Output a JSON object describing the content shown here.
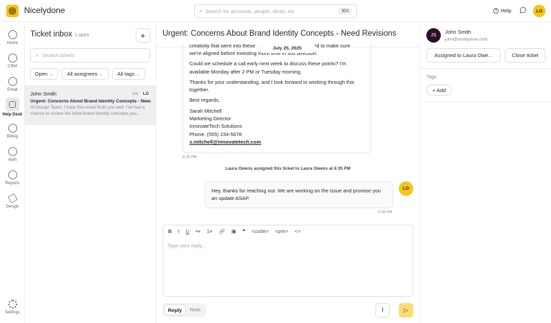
{
  "app": {
    "name": "Nicelydone",
    "search_placeholder": "Search for accounts, people, deals, etc",
    "search_shortcut": "⌘K",
    "help": "Help",
    "user_initials": "LO"
  },
  "sidebar": {
    "items": [
      {
        "label": "Home"
      },
      {
        "label": "CRM"
      },
      {
        "label": "Email"
      },
      {
        "label": "Help Desk"
      },
      {
        "label": "Billing"
      },
      {
        "label": "Auth"
      },
      {
        "label": "Reports"
      },
      {
        "label": "Design"
      }
    ],
    "settings": "Settings"
  },
  "inbox": {
    "title": "Ticket inbox",
    "count": "1 open",
    "add": "+",
    "search_placeholder": "Search tickets",
    "filters": [
      "Open",
      "All assignees",
      "All tags"
    ],
    "tickets": [
      {
        "name": "John Smith",
        "time": "1m",
        "assignee": "LO",
        "subject": "Urgent: Concerns About Brand Identity Concepts - Need...",
        "preview": "Hi Design Team, I hope this email finds you well. I've had a chance to review the initial brand identity concepts you..."
      }
    ]
  },
  "conversation": {
    "title": "Urgent: Concerns About Brand Identity Concepts - Need Revisions",
    "date": "July 25, 2025",
    "message": {
      "line_a": "creativity that went into these",
      "line_b": "ed to make sure",
      "p1_end": "we're aligned before investing more time in this direction.",
      "p2": "Could we schedule a call early next week to discuss these points? I'm available Monday after 2 PM or Tuesday morning.",
      "p3": "Thanks for your understanding, and I look forward to working through this together.",
      "p4": "Best regards,",
      "sig": [
        "Sarah Mitchell",
        "Marketing Director",
        "InnovateTech Solutions",
        "Phone: (555) 234-5678"
      ],
      "email": "s.mitchell@innovatetech.com",
      "time": "6:35 PM"
    },
    "event": "Laura Owens assigned this ticket to Laura Owens at 6:35 PM",
    "reply": {
      "text": "Hey, thanks for reaching out. We are working on the issue and promise you an update ASAP.",
      "time": "6:36 PM",
      "initials": "LO"
    },
    "editor": {
      "placeholder": "Type your reply...",
      "toolbar": [
        "B",
        "I",
        "U",
        "•≡",
        "1≡",
        "🔗",
        "▣",
        "❝",
        "<code>",
        "<pre>",
        "<>"
      ]
    },
    "modes": [
      "Reply",
      "Note"
    ]
  },
  "contact": {
    "initials": "JS",
    "name": "John Smith",
    "email": "john@nicelydone.club",
    "assigned": "Assigned to Laura Owe...",
    "close": "Close ticket",
    "tags_label": "Tags",
    "add_tag": "+ Add"
  },
  "colors": {
    "accent": "#f5c518",
    "contact_avatar": "#2b0f2a"
  }
}
